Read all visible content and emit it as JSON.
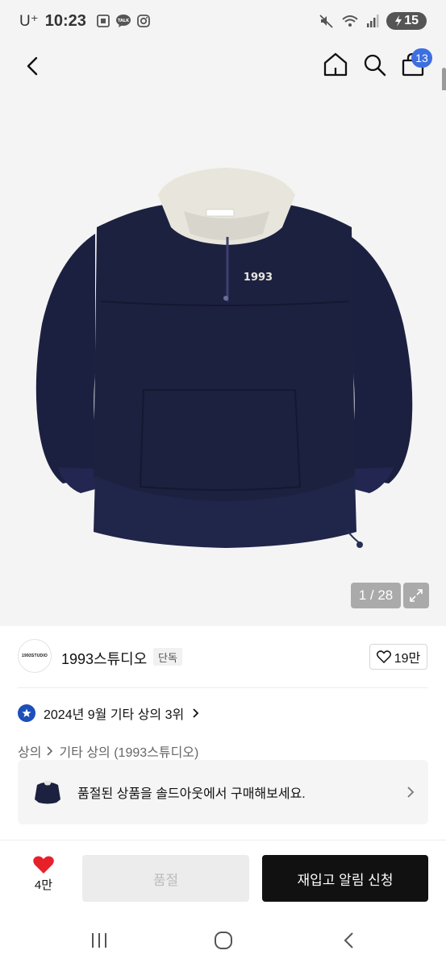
{
  "status_bar": {
    "carrier": "U⁺",
    "time": "10:23",
    "battery": "15"
  },
  "header": {
    "cart_count": "13"
  },
  "gallery": {
    "counter": "1 / 28",
    "logo_text": "1993"
  },
  "brand": {
    "logo_text": "1993STUDIO",
    "name": "1993스튜디오",
    "tag": "단독",
    "likes": "19만"
  },
  "ranking": {
    "text": "2024년 9월 기타 상의 3위"
  },
  "category": {
    "level1": "상의",
    "level2": "기타 상의 (1993스튜디오)"
  },
  "soldout_banner": {
    "text": "품절된 상품을 솔드아웃에서 구매해보세요."
  },
  "bottom_bar": {
    "wish_count": "4만",
    "soldout_label": "품절",
    "restock_label": "재입고 알림 신청"
  },
  "colors": {
    "badge_blue": "#3d6fe0",
    "rank_blue": "#1c4fb8",
    "heart_red": "#e8202a",
    "jacket_navy": "#1d2140",
    "collar_cream": "#e8e6dc"
  }
}
